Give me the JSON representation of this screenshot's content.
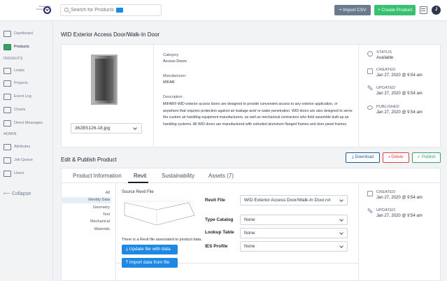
{
  "header": {
    "logo_text": "Powered by Concora Specs",
    "search_placeholder": "Search for Products",
    "import_csv_label": "+ Import CSV",
    "create_product_label": "+ Create Product",
    "avatar_initial": "J",
    "colors": {
      "import": "#6b7a8f",
      "create": "#38c172",
      "accent": "#1e88e5"
    }
  },
  "sidebar": {
    "dashboard": "Dashboard",
    "products": "Products",
    "insights": "INSIGHTS",
    "leads": "Leads",
    "projects": "Projects",
    "event_log": "Event Log",
    "charts": "Charts",
    "direct_messages": "Direct Messages",
    "admin": "ADMIN",
    "attributes": "Attributes",
    "job_queue": "Job Queue",
    "users": "Users",
    "collapse": "Collapse"
  },
  "product": {
    "title": "WID Exterior Access Door/Walk-In Door",
    "image_file": "362BS126-18.jpg",
    "category_label": "Category",
    "category": "Access Doors",
    "manufacturer_label": "Manufacturer",
    "manufacturer": "MIFAB",
    "description_label": "Description",
    "description": "MIFAB® WID exterior access doors are designed to provide convenient access to any exterior application, or anywhere that requires protection against air leakage and/ or water penetration. WID doors are also designed to serve the custom air handling equipment manufacturers, as well as mechanical contractors who field assemble built-up air handling systems. All WID doors are manufactured with extruded aluminum flanged frames and door panel frames."
  },
  "status_panel": {
    "status_label": "STATUS",
    "status_value": "Available",
    "created_label": "CREATED",
    "created_value": "Jan 27, 2020 @ 9:54 am",
    "updated_label": "UPDATED",
    "updated_value": "Jan 27, 2020 @ 9:54 am",
    "published_label": "PUBLISHED",
    "published_value": "Jan 27, 2020 @ 9:54 am"
  },
  "edit": {
    "title": "Edit & Publish Product",
    "download_label": "Download",
    "delete_label": "Delete",
    "publish_label": "Publish",
    "tabs": [
      "Product Information",
      "Revit",
      "Sustainability",
      "Assets (7)"
    ],
    "sub_nav": [
      "All",
      "Identity Data",
      "Geometry",
      "Text",
      "Mechanical",
      "Materials"
    ],
    "source_title": "Source Revit File",
    "file_note": "There is a Revit file associated to product data.",
    "update_btn": "Update file with data",
    "import_btn": "Import data from file",
    "revit_file_label": "Revit File",
    "revit_file_value": "WID Exterior Access Door/Walk-In Door.rvt",
    "type_catalog_label": "Type Catalog",
    "type_catalog_value": "None",
    "lookup_table_label": "Lookup Table",
    "lookup_table_value": "None",
    "ies_profile_label": "IES Profile",
    "ies_profile_value": "None",
    "created_label": "CREATED",
    "created_value": "Jan 27, 2020 @ 9:54 am",
    "updated_label": "UPDATED",
    "updated_value": "Jan 27, 2020 @ 9:54 am"
  }
}
